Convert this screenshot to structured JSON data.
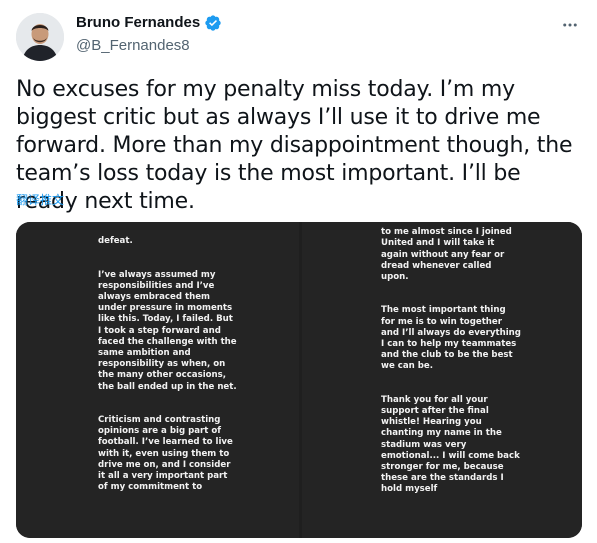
{
  "author": {
    "display_name": "Bruno Fernandes",
    "handle": "@B_Fernandes8",
    "verified_icon": "verified-badge-icon",
    "avatar_icon": "avatar-image"
  },
  "tweet": {
    "text": "No excuses for my penalty miss today. I’m my biggest critic but as always I’ll use it to drive me forward. More than my disappointment though, the team’s loss today is the most important. I’ll be ready next time.",
    "translate_label": "翻译推文"
  },
  "media": {
    "left_story": [
      "defeat.",
      "I’ve always assumed my responsibilities and I’ve always embraced them under pressure in moments like this. Today, I failed. But I took a step forward and faced the challenge with the same ambition and responsibility as when, on the many other occasions, the ball ended up in the net.",
      "Criticism and contrasting opinions are a big part of football. I’ve learned to live with it, even using them to drive me on, and I consider it all a very important part of my commitment to"
    ],
    "right_story": [
      "to me almost since I joined United and I will take it again without any fear or dread whenever called upon.",
      "The most important thing for me is to win together and I’ll always do everything I can to help my teammates and the club to be the best we can be.",
      "Thank you for all your support after the final whistle! Hearing you chanting my name in the stadium was very emotional... I will come back stronger for me, because these are the standards I hold myself"
    ]
  },
  "colors": {
    "accent": "#1d9bf0",
    "secondary_text": "#536471",
    "media_bg": "#242424"
  }
}
